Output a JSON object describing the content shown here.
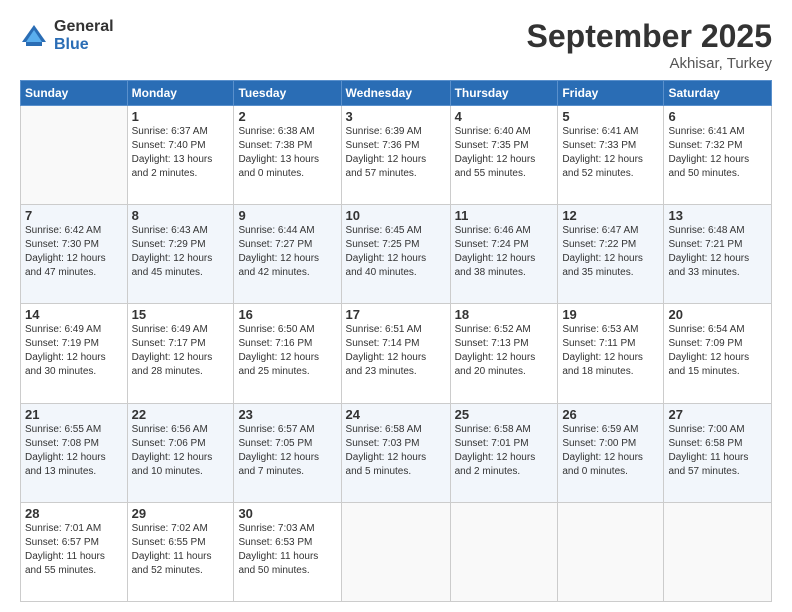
{
  "logo": {
    "general": "General",
    "blue": "Blue"
  },
  "header": {
    "month": "September 2025",
    "location": "Akhisar, Turkey"
  },
  "weekdays": [
    "Sunday",
    "Monday",
    "Tuesday",
    "Wednesday",
    "Thursday",
    "Friday",
    "Saturday"
  ],
  "weeks": [
    [
      {
        "day": "",
        "info": ""
      },
      {
        "day": "1",
        "info": "Sunrise: 6:37 AM\nSunset: 7:40 PM\nDaylight: 13 hours\nand 2 minutes."
      },
      {
        "day": "2",
        "info": "Sunrise: 6:38 AM\nSunset: 7:38 PM\nDaylight: 13 hours\nand 0 minutes."
      },
      {
        "day": "3",
        "info": "Sunrise: 6:39 AM\nSunset: 7:36 PM\nDaylight: 12 hours\nand 57 minutes."
      },
      {
        "day": "4",
        "info": "Sunrise: 6:40 AM\nSunset: 7:35 PM\nDaylight: 12 hours\nand 55 minutes."
      },
      {
        "day": "5",
        "info": "Sunrise: 6:41 AM\nSunset: 7:33 PM\nDaylight: 12 hours\nand 52 minutes."
      },
      {
        "day": "6",
        "info": "Sunrise: 6:41 AM\nSunset: 7:32 PM\nDaylight: 12 hours\nand 50 minutes."
      }
    ],
    [
      {
        "day": "7",
        "info": "Sunrise: 6:42 AM\nSunset: 7:30 PM\nDaylight: 12 hours\nand 47 minutes."
      },
      {
        "day": "8",
        "info": "Sunrise: 6:43 AM\nSunset: 7:29 PM\nDaylight: 12 hours\nand 45 minutes."
      },
      {
        "day": "9",
        "info": "Sunrise: 6:44 AM\nSunset: 7:27 PM\nDaylight: 12 hours\nand 42 minutes."
      },
      {
        "day": "10",
        "info": "Sunrise: 6:45 AM\nSunset: 7:25 PM\nDaylight: 12 hours\nand 40 minutes."
      },
      {
        "day": "11",
        "info": "Sunrise: 6:46 AM\nSunset: 7:24 PM\nDaylight: 12 hours\nand 38 minutes."
      },
      {
        "day": "12",
        "info": "Sunrise: 6:47 AM\nSunset: 7:22 PM\nDaylight: 12 hours\nand 35 minutes."
      },
      {
        "day": "13",
        "info": "Sunrise: 6:48 AM\nSunset: 7:21 PM\nDaylight: 12 hours\nand 33 minutes."
      }
    ],
    [
      {
        "day": "14",
        "info": "Sunrise: 6:49 AM\nSunset: 7:19 PM\nDaylight: 12 hours\nand 30 minutes."
      },
      {
        "day": "15",
        "info": "Sunrise: 6:49 AM\nSunset: 7:17 PM\nDaylight: 12 hours\nand 28 minutes."
      },
      {
        "day": "16",
        "info": "Sunrise: 6:50 AM\nSunset: 7:16 PM\nDaylight: 12 hours\nand 25 minutes."
      },
      {
        "day": "17",
        "info": "Sunrise: 6:51 AM\nSunset: 7:14 PM\nDaylight: 12 hours\nand 23 minutes."
      },
      {
        "day": "18",
        "info": "Sunrise: 6:52 AM\nSunset: 7:13 PM\nDaylight: 12 hours\nand 20 minutes."
      },
      {
        "day": "19",
        "info": "Sunrise: 6:53 AM\nSunset: 7:11 PM\nDaylight: 12 hours\nand 18 minutes."
      },
      {
        "day": "20",
        "info": "Sunrise: 6:54 AM\nSunset: 7:09 PM\nDaylight: 12 hours\nand 15 minutes."
      }
    ],
    [
      {
        "day": "21",
        "info": "Sunrise: 6:55 AM\nSunset: 7:08 PM\nDaylight: 12 hours\nand 13 minutes."
      },
      {
        "day": "22",
        "info": "Sunrise: 6:56 AM\nSunset: 7:06 PM\nDaylight: 12 hours\nand 10 minutes."
      },
      {
        "day": "23",
        "info": "Sunrise: 6:57 AM\nSunset: 7:05 PM\nDaylight: 12 hours\nand 7 minutes."
      },
      {
        "day": "24",
        "info": "Sunrise: 6:58 AM\nSunset: 7:03 PM\nDaylight: 12 hours\nand 5 minutes."
      },
      {
        "day": "25",
        "info": "Sunrise: 6:58 AM\nSunset: 7:01 PM\nDaylight: 12 hours\nand 2 minutes."
      },
      {
        "day": "26",
        "info": "Sunrise: 6:59 AM\nSunset: 7:00 PM\nDaylight: 12 hours\nand 0 minutes."
      },
      {
        "day": "27",
        "info": "Sunrise: 7:00 AM\nSunset: 6:58 PM\nDaylight: 11 hours\nand 57 minutes."
      }
    ],
    [
      {
        "day": "28",
        "info": "Sunrise: 7:01 AM\nSunset: 6:57 PM\nDaylight: 11 hours\nand 55 minutes."
      },
      {
        "day": "29",
        "info": "Sunrise: 7:02 AM\nSunset: 6:55 PM\nDaylight: 11 hours\nand 52 minutes."
      },
      {
        "day": "30",
        "info": "Sunrise: 7:03 AM\nSunset: 6:53 PM\nDaylight: 11 hours\nand 50 minutes."
      },
      {
        "day": "",
        "info": ""
      },
      {
        "day": "",
        "info": ""
      },
      {
        "day": "",
        "info": ""
      },
      {
        "day": "",
        "info": ""
      }
    ]
  ]
}
